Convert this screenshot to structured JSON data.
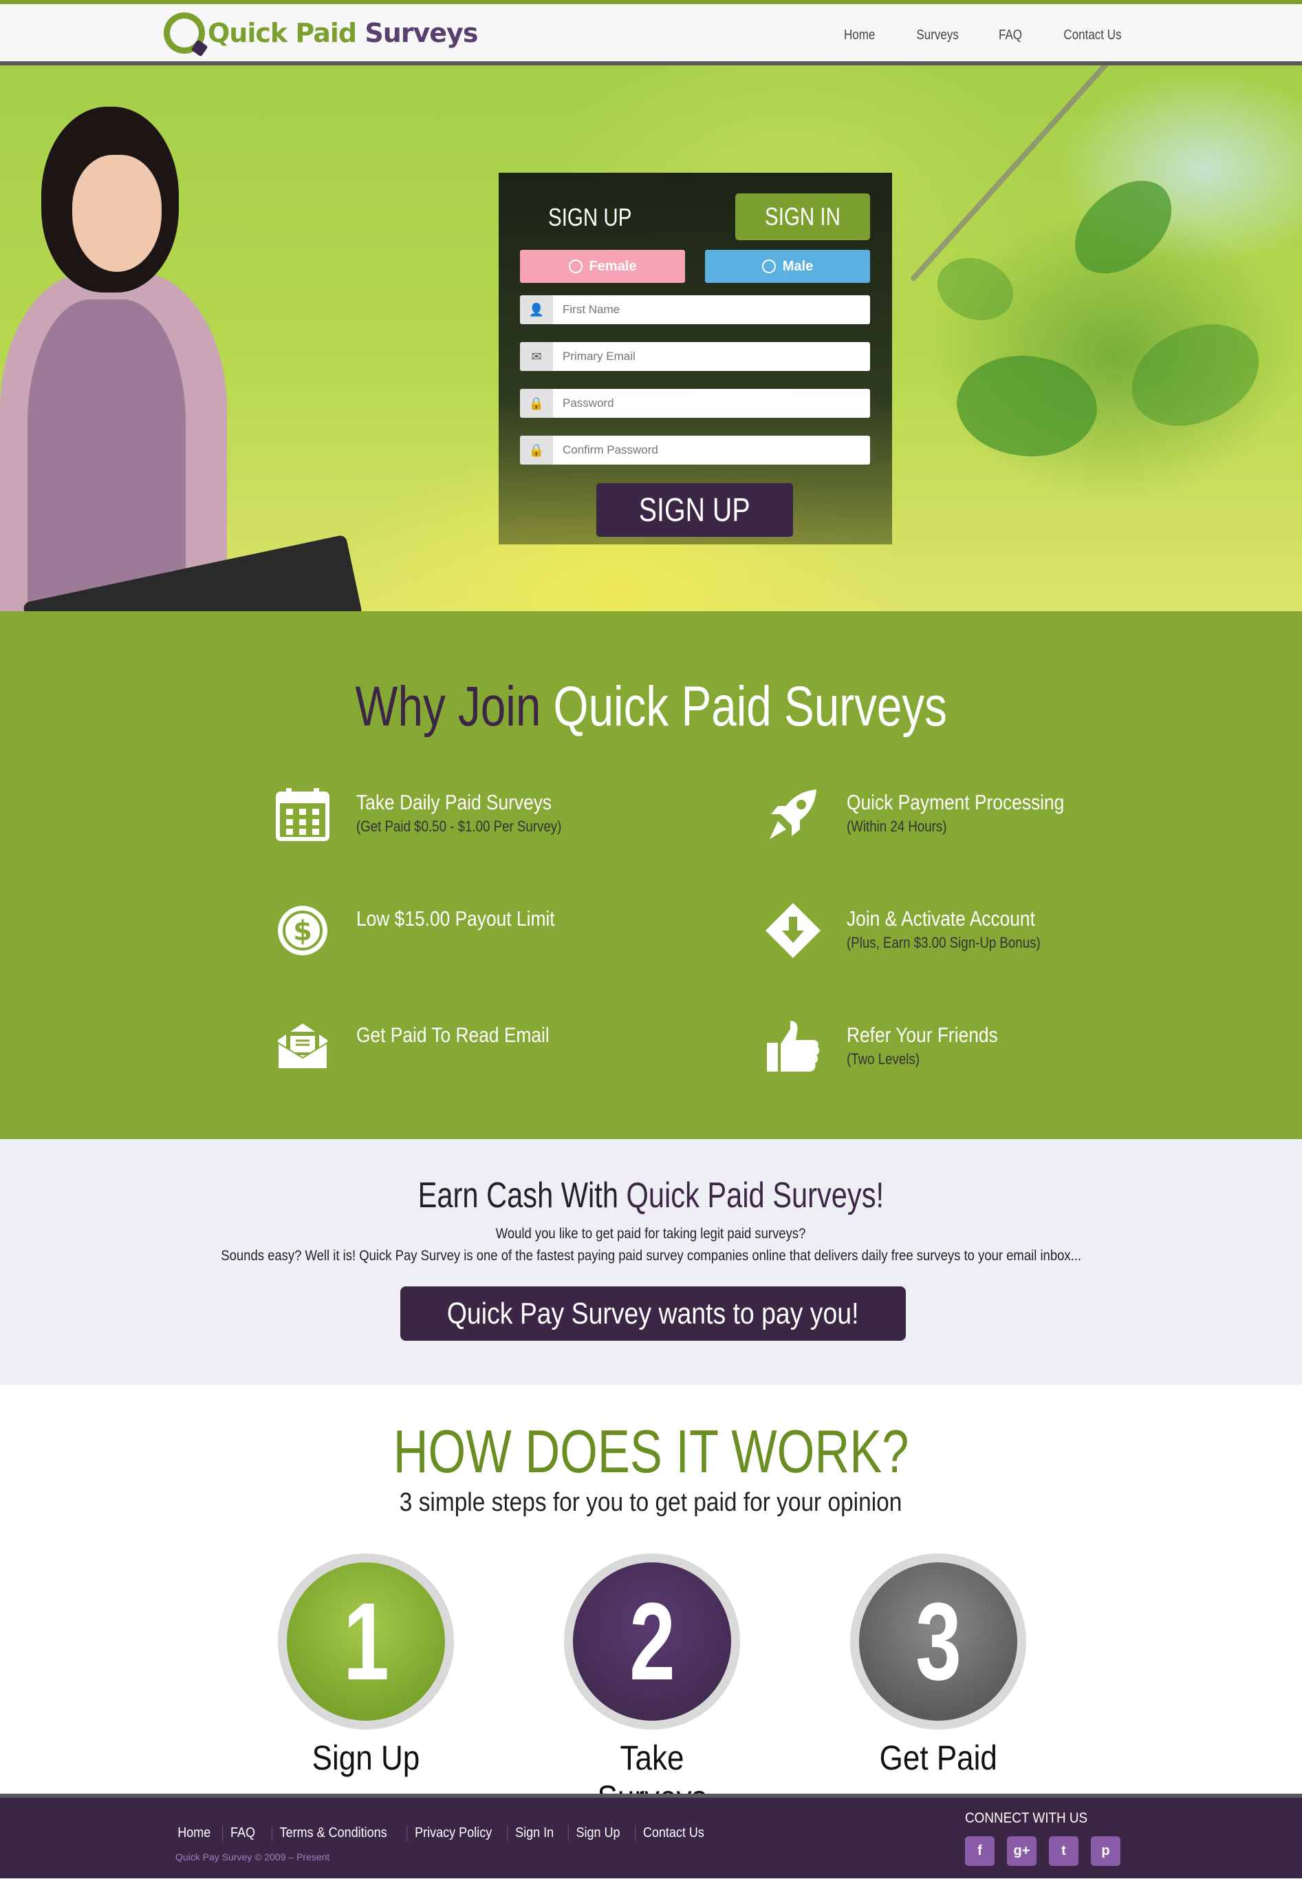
{
  "header": {
    "logo_part1": "Quick Paid",
    "logo_part2": "Surveys",
    "nav": [
      "Home",
      "Surveys",
      "FAQ",
      "Contact Us"
    ]
  },
  "signup_form": {
    "tab_signup": "SIGN UP",
    "tab_signin": "SIGN IN",
    "gender_female": "Female",
    "gender_male": "Male",
    "first_name_placeholder": "First Name",
    "email_placeholder": "Primary Email",
    "password_placeholder": "Password",
    "confirm_password_placeholder": "Confirm Password",
    "submit_label": "SIGN UP"
  },
  "why_join": {
    "title_part1": "Why Join ",
    "title_part2": "Quick Paid Surveys",
    "features": [
      {
        "title": "Take Daily Paid Surveys",
        "subtitle": "(Get Paid $0.50 - $1.00 Per Survey)",
        "icon": "calendar-icon"
      },
      {
        "title": "Quick Payment Processing",
        "subtitle": "(Within 24 Hours)",
        "icon": "rocket-icon"
      },
      {
        "title": "Low $15.00 Payout Limit",
        "subtitle": "",
        "icon": "dollar-icon"
      },
      {
        "title": "Join & Activate Account",
        "subtitle": "(Plus, Earn $3.00 Sign-Up Bonus)",
        "icon": "download-icon"
      },
      {
        "title": "Get Paid To Read Email",
        "subtitle": "",
        "icon": "envelope-icon"
      },
      {
        "title": "Refer Your Friends",
        "subtitle": "(Two Levels)",
        "icon": "thumbs-up-icon"
      }
    ]
  },
  "earn": {
    "title_part1": "Earn Cash With ",
    "title_part2": "Quick Paid Surveys!",
    "line1": "Would you like to get paid for taking legit paid surveys?",
    "line2": "Sounds easy? Well it is! Quick Pay Survey is one of the fastest paying paid survey companies online that delivers daily free surveys to your email inbox...",
    "cta": "Quick Pay Survey wants to pay you!"
  },
  "how": {
    "title": "HOW DOES IT WORK?",
    "subtitle": "3 simple steps for you to get paid for your opinion",
    "steps": [
      {
        "number": "1",
        "label": "Sign Up"
      },
      {
        "number": "2",
        "label": "Take Surveys"
      },
      {
        "number": "3",
        "label": "Get Paid"
      }
    ]
  },
  "footer": {
    "links": [
      "Home",
      "FAQ",
      "Terms & Conditions",
      "Privacy Policy",
      "Sign In",
      "Sign Up",
      "Contact Us"
    ],
    "copyright": "Quick Pay Survey © 2009 – Present",
    "connect": "CONNECT WITH US",
    "socials": [
      {
        "glyph": "f",
        "icon": "facebook-icon"
      },
      {
        "glyph": "g+",
        "icon": "google-plus-icon"
      },
      {
        "glyph": "t",
        "icon": "twitter-icon"
      },
      {
        "glyph": "p",
        "icon": "pinterest-icon"
      }
    ]
  },
  "colors": {
    "brand_green": "#7ba02f",
    "section_green": "#86a834",
    "brand_purple": "#3b2646",
    "female_pink": "#f5a3b5",
    "male_blue": "#5ab0e0"
  }
}
